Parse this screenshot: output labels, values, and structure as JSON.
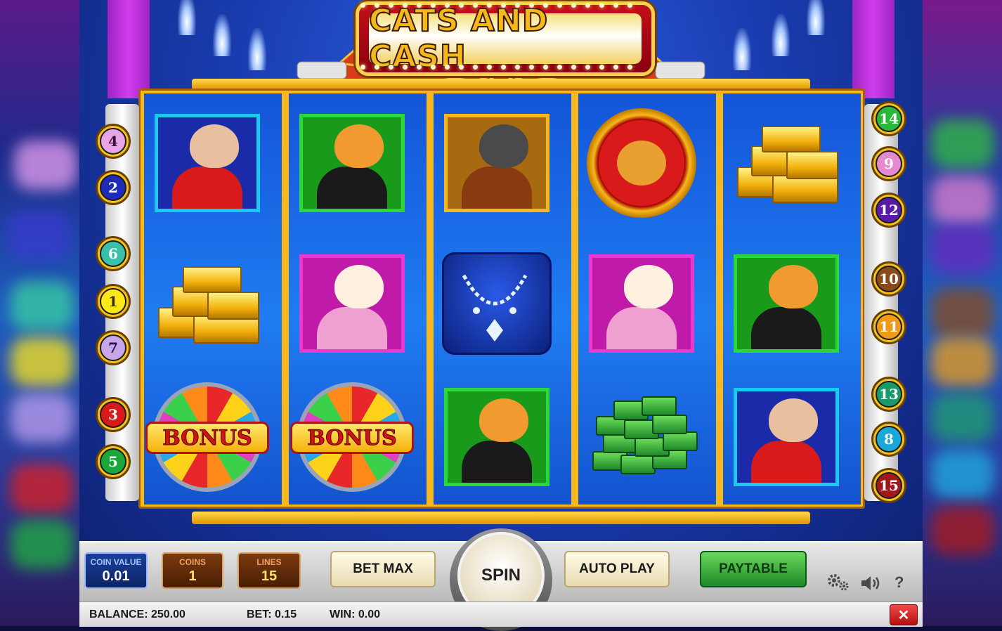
{
  "game": {
    "title": "CATS AND CASH"
  },
  "lines_left": [
    {
      "n": "4",
      "color": "#e9a6e6",
      "text": "#3a0a3a"
    },
    {
      "n": "2",
      "color": "#1e2ab8",
      "text": "#ffffff"
    },
    {
      "n": "6",
      "color": "#3ac0a8",
      "text": "#ffffff"
    },
    {
      "n": "1",
      "color": "#ffe81a",
      "text": "#3a3000"
    },
    {
      "n": "7",
      "color": "#c8a6ea",
      "text": "#2a0a4a"
    },
    {
      "n": "3",
      "color": "#d81a1a",
      "text": "#ffffff"
    },
    {
      "n": "5",
      "color": "#1aa83a",
      "text": "#ffffff"
    }
  ],
  "lines_right": [
    {
      "n": "14",
      "color": "#2ab83a",
      "text": "#ffffff"
    },
    {
      "n": "9",
      "color": "#e68ad0",
      "text": "#ffffff"
    },
    {
      "n": "12",
      "color": "#5a1aa8",
      "text": "#ffffff"
    },
    {
      "n": "10",
      "color": "#8a4a1a",
      "text": "#ffffff"
    },
    {
      "n": "11",
      "color": "#f09a1a",
      "text": "#ffffff"
    },
    {
      "n": "13",
      "color": "#1a9a6a",
      "text": "#ffffff"
    },
    {
      "n": "8",
      "color": "#1aa8d8",
      "text": "#ffffff"
    },
    {
      "n": "15",
      "color": "#a01a1a",
      "text": "#ffffff"
    }
  ],
  "reels": [
    [
      "cat-lady-red",
      "gold-bars",
      "bonus-wheel"
    ],
    [
      "tiger-cat",
      "white-persian-cat",
      "bonus-wheel"
    ],
    [
      "gangster-cat",
      "diamond-necklace",
      "tiger-cat"
    ],
    [
      "singer-cat",
      "white-persian-cat",
      "cash-stack"
    ],
    [
      "gold-bars",
      "tiger-cat",
      "cat-lady-red"
    ]
  ],
  "symbols": {
    "bonus_label": "BONUS"
  },
  "controls": {
    "coin_value": {
      "label": "COIN VALUE",
      "value": "0.01"
    },
    "coins": {
      "label": "COINS",
      "value": "1"
    },
    "lines": {
      "label": "LINES",
      "value": "15"
    },
    "bet_max": "BET MAX",
    "spin": "SPIN",
    "auto_play": "AUTO PLAY",
    "paytable": "PAYTABLE",
    "help": "?"
  },
  "status": {
    "balance": "BALANCE: 250.00",
    "bet": "BET: 0.15",
    "win": "WIN: 0.00"
  },
  "icons": [
    "settings-gears-icon",
    "sound-icon",
    "help-icon",
    "close-icon"
  ],
  "colors": {
    "reel_blue": "#1f7cf2",
    "frame_gold": "#f6b81c",
    "paytable_green": "#2ea83a",
    "close_red": "#d62020"
  }
}
